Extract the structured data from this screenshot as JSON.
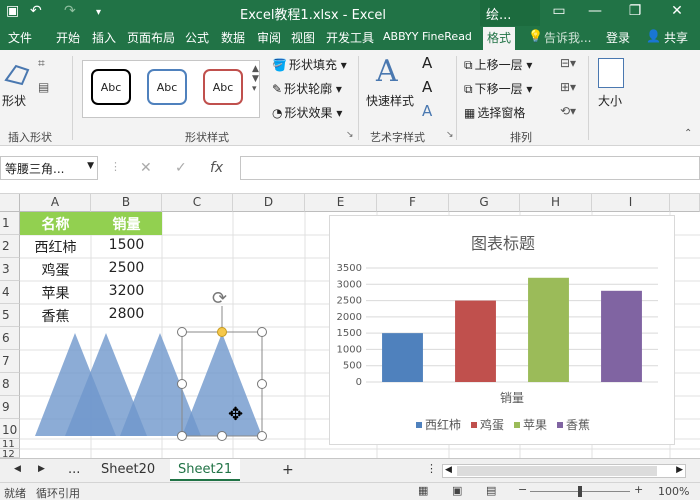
{
  "titlebar": {
    "title": "Excel教程1.xlsx - Excel",
    "context_tab": "绘...",
    "minimize": "—",
    "restore": "❐",
    "close": "✕"
  },
  "tabs": [
    {
      "label": "文件"
    },
    {
      "label": "开始"
    },
    {
      "label": "插入"
    },
    {
      "label": "页面布局"
    },
    {
      "label": "公式"
    },
    {
      "label": "数据"
    },
    {
      "label": "审阅"
    },
    {
      "label": "视图"
    },
    {
      "label": "开发工具"
    },
    {
      "label": "ABBYY FineRead"
    },
    {
      "label": "格式"
    }
  ],
  "tell_me": "告诉我...",
  "login": "登录",
  "share": "共享",
  "ribbon": {
    "insert_shapes": {
      "shape_label": "形状",
      "group_label": "插入形状"
    },
    "shape_styles": {
      "abc": [
        "Abc",
        "Abc",
        "Abc"
      ],
      "fill": "形状填充",
      "outline": "形状轮廓",
      "effects": "形状效果",
      "group_label": "形状样式"
    },
    "wordart": {
      "quick_styles": "快速样式",
      "text_a": "A",
      "group_label": "艺术字样式"
    },
    "arrange": {
      "bring_forward": "上移一层",
      "send_backward": "下移一层",
      "selection_pane": "选择窗格",
      "group_label": "排列"
    },
    "size": {
      "label": "大小"
    }
  },
  "formula_bar": {
    "name_box": "等腰三角...",
    "fx": "fx",
    "value": ""
  },
  "columns": [
    "A",
    "B",
    "C",
    "D",
    "E",
    "F",
    "G",
    "H",
    "I"
  ],
  "rows": [
    "1",
    "2",
    "3",
    "4",
    "5",
    "6",
    "7",
    "8",
    "9",
    "10",
    "11",
    "12"
  ],
  "table": {
    "headers": [
      "名称",
      "销量"
    ],
    "rows": [
      [
        "西红柿",
        "1500"
      ],
      [
        "鸡蛋",
        "2500"
      ],
      [
        "苹果",
        "3200"
      ],
      [
        "香蕉",
        "2800"
      ]
    ]
  },
  "chart_data": {
    "type": "bar",
    "title": "图表标题",
    "xlabel": "销量",
    "ylabel": "",
    "ylim": [
      0,
      3500
    ],
    "yticks": [
      0,
      500,
      1000,
      1500,
      2000,
      2500,
      3000,
      3500
    ],
    "series": [
      {
        "name": "西红柿",
        "values": [
          1500
        ],
        "color": "#4f81bd"
      },
      {
        "name": "鸡蛋",
        "values": [
          2500
        ],
        "color": "#c0504d"
      },
      {
        "name": "苹果",
        "values": [
          3200
        ],
        "color": "#9bbb59"
      },
      {
        "name": "香蕉",
        "values": [
          2800
        ],
        "color": "#8064a2"
      }
    ],
    "legend": "bottom",
    "grid": true
  },
  "sheets": {
    "more": "...",
    "tabs": [
      "Sheet20",
      "Sheet21"
    ],
    "active": "Sheet21",
    "add": "+"
  },
  "status": {
    "ready": "就绪",
    "circular": "循环引用",
    "zoom": "100%"
  }
}
